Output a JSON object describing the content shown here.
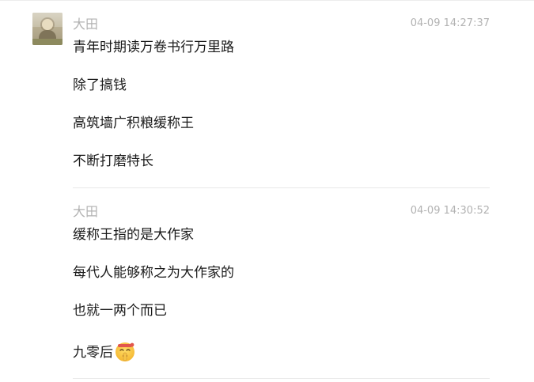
{
  "messages": [
    {
      "sender": "大田",
      "timestamp": "04-09 14:27:37",
      "lines": [
        "青年时期读万卷书行万里路",
        "除了搞钱",
        "高筑墙广积粮缓称王",
        "不断打磨特长"
      ]
    },
    {
      "sender": "大田",
      "timestamp": "04-09 14:30:52",
      "lines": [
        "缓称王指的是大作家",
        "每代人能够称之为大作家的",
        "也就一两个而已",
        "九零后"
      ],
      "trailing_emoji": "shushing-face-emoji"
    }
  ],
  "avatar_icon": "avatar-photo",
  "colors": {
    "meta_text": "#b2b2b2",
    "body_text": "#1a1a1a",
    "divider": "#e9e9e9"
  }
}
